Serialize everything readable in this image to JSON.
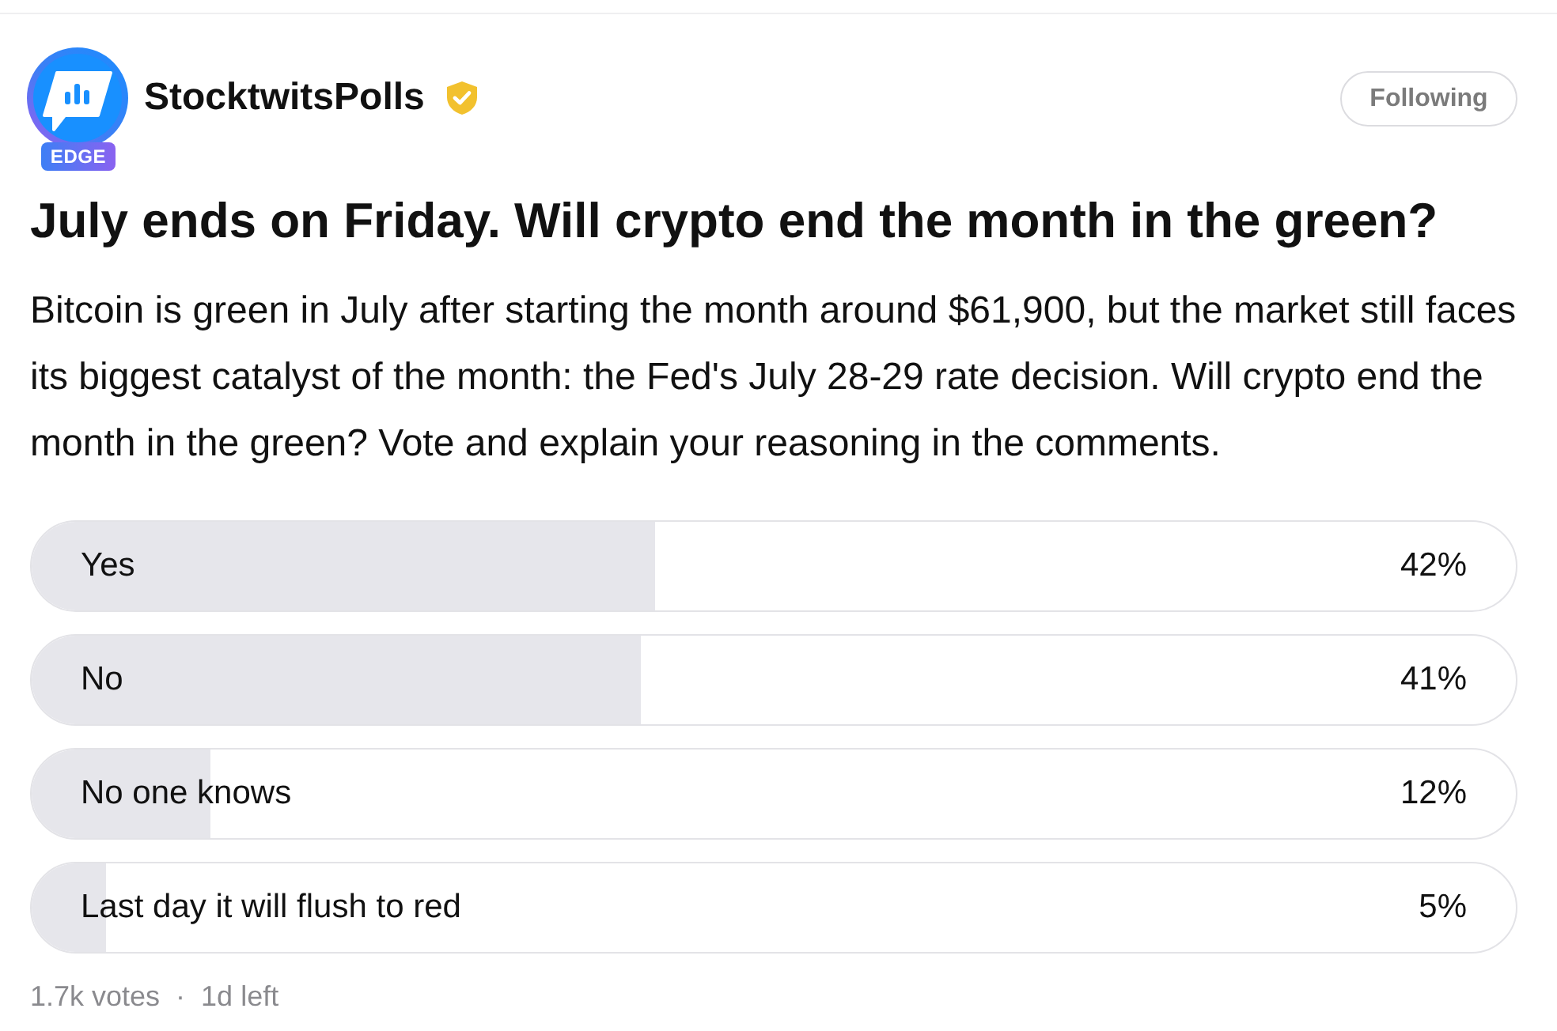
{
  "post": {
    "author": {
      "name": "StocktwitsPolls",
      "badge": "EDGE",
      "verified": true
    },
    "follow_button": {
      "label": "Following"
    },
    "title": "July ends on Friday. Will crypto end the month in the green?",
    "body": "Bitcoin is green in July after starting the month around $61,900, but the market still faces its biggest catalyst of the month: the Fed's July 28-29 rate decision. Will crypto end the month in the green? Vote and explain your reasoning in the comments.",
    "poll": {
      "options": [
        {
          "label": "Yes",
          "percent": "42%",
          "level": 0.42
        },
        {
          "label": "No",
          "percent": "41%",
          "level": 0.41
        },
        {
          "label": "No one knows",
          "percent": "12%",
          "level": 0.12
        },
        {
          "label": "Last day it will flush to red",
          "percent": "5%",
          "level": 0.05
        }
      ],
      "votes": "1.7k votes",
      "separator": "·",
      "time_left": "1d left"
    }
  }
}
